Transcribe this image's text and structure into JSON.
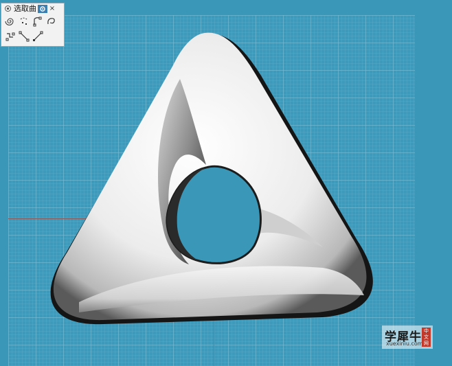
{
  "toolbar": {
    "title": "选取曲",
    "close_glyph": "×",
    "buttons": [
      {
        "name": "select-spiral-curve-button",
        "icon": "spiral-curve-icon"
      },
      {
        "name": "select-points-button",
        "icon": "points-select-icon"
      },
      {
        "name": "select-open-curve-button",
        "icon": "open-curve-select-icon"
      },
      {
        "name": "select-freeform-curve-button",
        "icon": "freeform-curve-icon"
      },
      {
        "name": "select-polyline-button",
        "icon": "polyline-select-icon"
      },
      {
        "name": "select-line-button",
        "icon": "line-select-icon"
      },
      {
        "name": "select-diagonal-button",
        "icon": "diagonal-select-icon"
      }
    ]
  },
  "watermark": {
    "main": "学犀牛",
    "sub": "xuexiniu.com",
    "badge": "中文网"
  },
  "colors": {
    "viewport_bg": "#3a97b8",
    "grid_line": "#78bed7",
    "model_white": "#f4f4f4",
    "model_shadow": "#1a1a1a"
  }
}
